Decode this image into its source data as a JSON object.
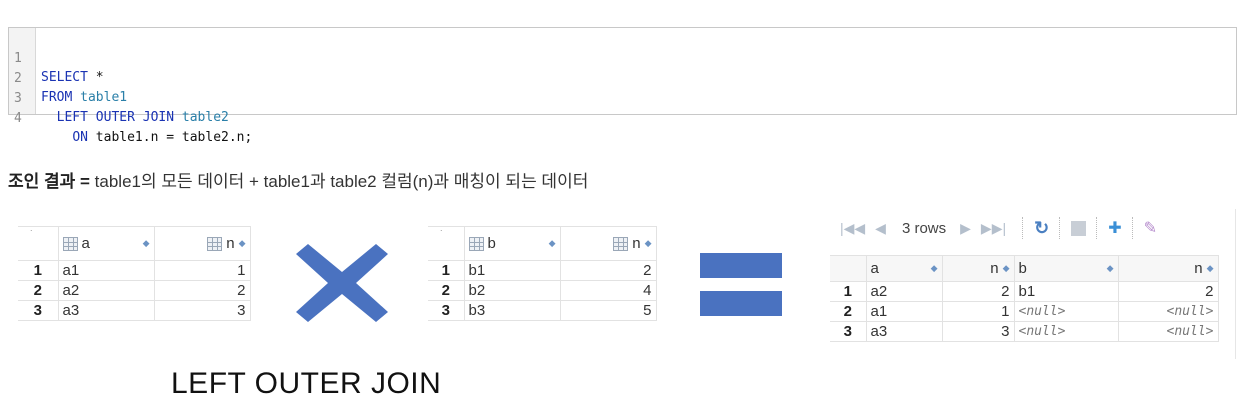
{
  "code": {
    "lines": [
      {
        "num": "1",
        "kw1": "SELECT",
        "rest": " *"
      },
      {
        "num": "2",
        "kw1": "FROM",
        "tbl": "table1"
      },
      {
        "num": "3",
        "kw1": "LEFT OUTER JOIN",
        "tbl": "table2"
      },
      {
        "num": "4",
        "kw1": "ON",
        "rest": " table1.n = table2.n;"
      }
    ]
  },
  "description": {
    "bold": "조인 결과 =",
    "text": " table1의 모든 데이터 + table1과 table2 컬럼(n)과 매칭이 되는 데이터"
  },
  "table1": {
    "columns": [
      "a",
      "n"
    ],
    "rows": [
      {
        "rn": "1",
        "a": "a1",
        "n": "1"
      },
      {
        "rn": "2",
        "a": "a2",
        "n": "2"
      },
      {
        "rn": "3",
        "a": "a3",
        "n": "3"
      }
    ]
  },
  "table2": {
    "columns": [
      "b",
      "n"
    ],
    "rows": [
      {
        "rn": "1",
        "b": "b1",
        "n": "2"
      },
      {
        "rn": "2",
        "b": "b2",
        "n": "4"
      },
      {
        "rn": "3",
        "b": "b3",
        "n": "5"
      }
    ]
  },
  "result": {
    "toolbar": {
      "rows_label": "3 rows"
    },
    "columns": [
      "a",
      "n",
      "b",
      "n"
    ],
    "rows": [
      {
        "rn": "1",
        "a": "a2",
        "n1": "2",
        "b": "b1",
        "n2": "2"
      },
      {
        "rn": "2",
        "a": "a1",
        "n1": "1",
        "b": "<null>",
        "n2": "<null>"
      },
      {
        "rn": "3",
        "a": "a3",
        "n1": "3",
        "b": "<null>",
        "n2": "<null>"
      }
    ]
  },
  "caption": "LEFT OUTER JOIN",
  "colors": {
    "accent": "#4a72c0",
    "keyword": "#1a33b3",
    "table_name": "#2a7fa8"
  }
}
